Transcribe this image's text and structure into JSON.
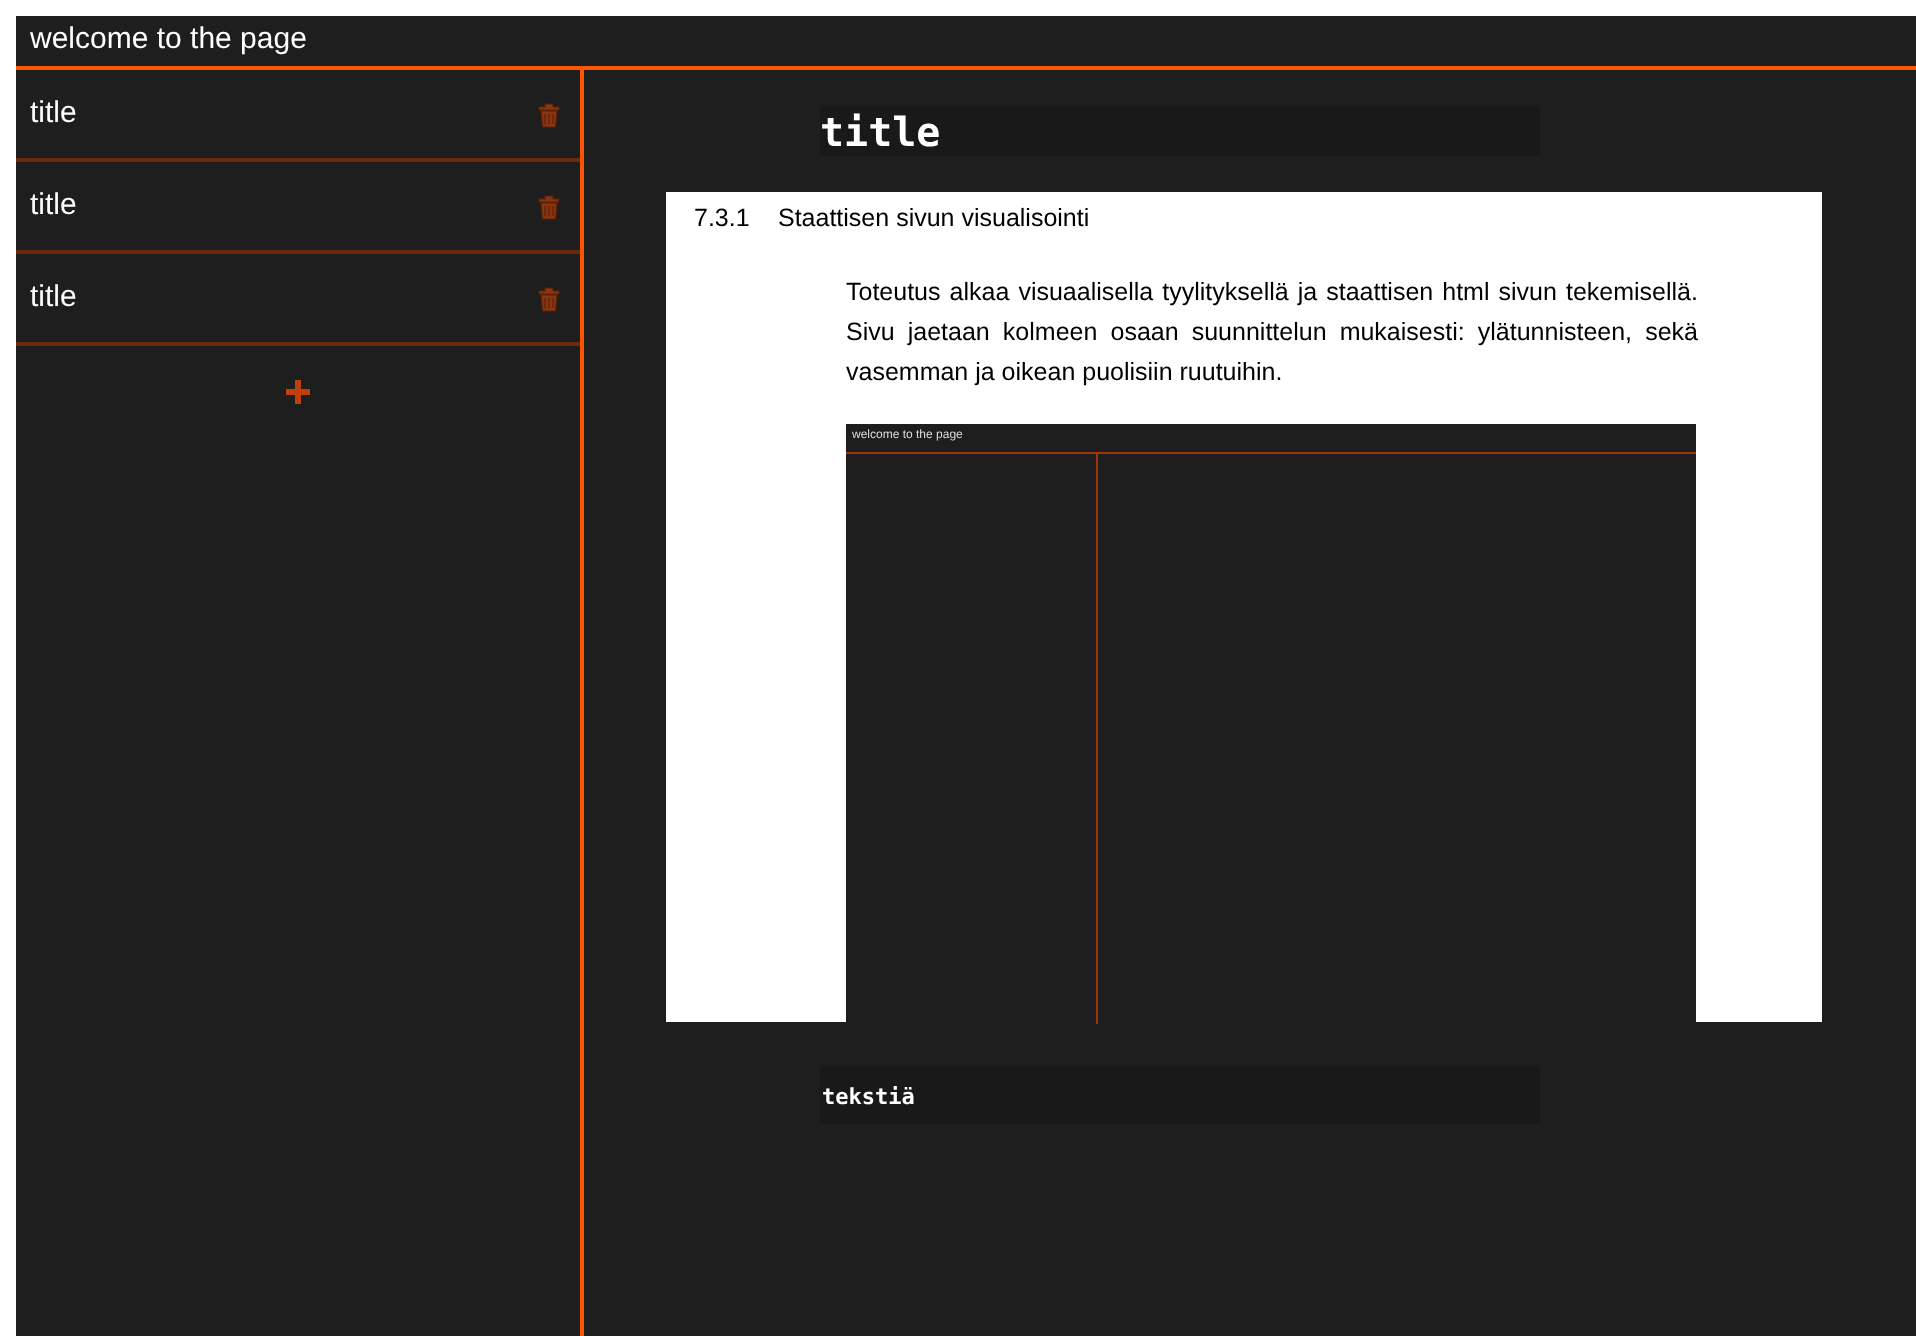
{
  "header": {
    "title": "welcome to the page"
  },
  "notes": [
    {
      "title": "title"
    },
    {
      "title": "title"
    },
    {
      "title": "title"
    }
  ],
  "editor": {
    "title_field": {
      "value": "title"
    },
    "document": {
      "section_number": "7.3.1",
      "section_title": "Staattisen sivun visualisointi",
      "paragraph": "Toteutus alkaa visuaalisella tyylityksellä ja staattisen html sivun tekemisellä. Sivu jaetaan kolmeen osaan suunnittelun mukaisesti: ylätunnisteen, sekä vasemman ja oikean puolisiin ruutuihin.",
      "screenshot": {
        "header_title": "welcome to the page"
      }
    },
    "text_field": {
      "value": "tekstiä"
    }
  }
}
